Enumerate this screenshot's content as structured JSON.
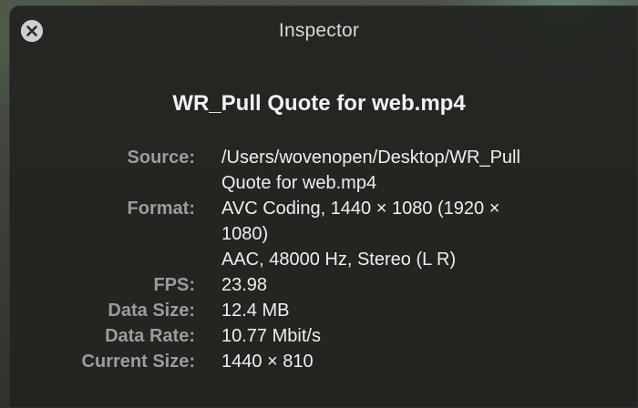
{
  "window": {
    "title": "Inspector",
    "close_icon": "close-icon"
  },
  "file": {
    "name": "WR_Pull Quote for web.mp4"
  },
  "info": {
    "source_label": "Source:",
    "source_value_line1": "/Users/wovenopen/Desktop/WR_Pull",
    "source_value_line2": "Quote for web.mp4",
    "format_label": "Format:",
    "format_value_line1": "AVC Coding, 1440 × 1080 (1920 ×",
    "format_value_line2": "1080)",
    "format_value_line3": "AAC, 48000 Hz, Stereo (L R)",
    "fps_label": "FPS:",
    "fps_value": "23.98",
    "data_size_label": "Data Size:",
    "data_size_value": "12.4 MB",
    "data_rate_label": "Data Rate:",
    "data_rate_value": "10.77 Mbit/s",
    "current_size_label": "Current Size:",
    "current_size_value": "1440 × 810"
  }
}
